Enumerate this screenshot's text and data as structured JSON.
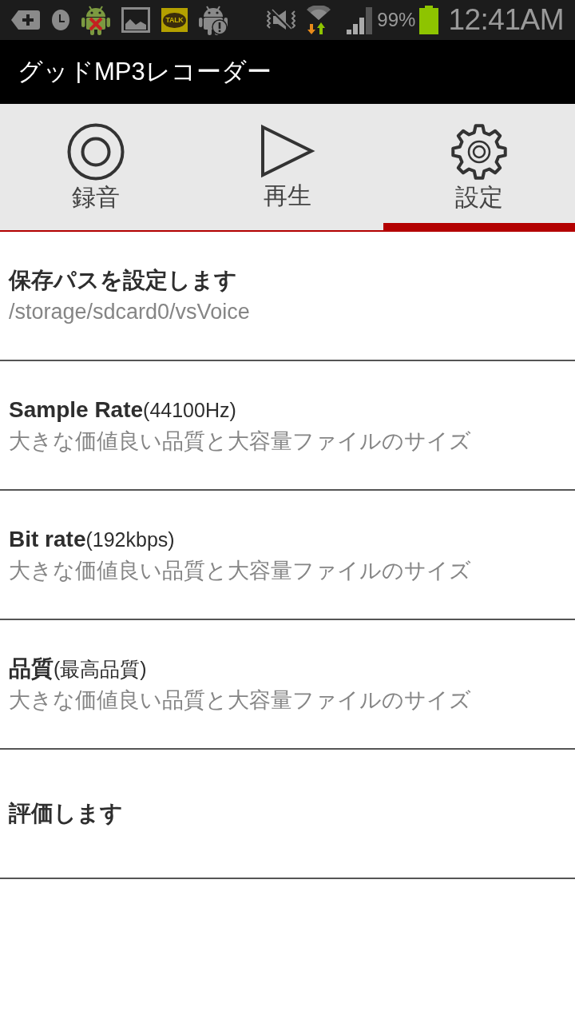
{
  "status_bar": {
    "chat_badge": "TALK",
    "battery_percent": "99%",
    "time": "12:41AM"
  },
  "title_bar": {
    "title": "グッドMP3レコーダー"
  },
  "tabs": [
    {
      "label": "録音",
      "selected": false
    },
    {
      "label": "再生",
      "selected": false
    },
    {
      "label": "設定",
      "selected": true
    }
  ],
  "settings": [
    {
      "title": "保存パスを設定します",
      "summary": "/storage/sdcard0/vsVoice"
    },
    {
      "title": "Sample Rate",
      "detail": "(44100Hz)",
      "summary": "大きな価値良い品質と大容量ファイルのサイズ"
    },
    {
      "title": "Bit rate",
      "detail": "(192kbps)",
      "summary": "大きな価値良い品質と大容量ファイルのサイズ"
    },
    {
      "title": "品質",
      "detail": "(最高品質)",
      "summary": "大きな価値良い品質と大容量ファイルのサイズ"
    },
    {
      "title": "評価します"
    }
  ]
}
